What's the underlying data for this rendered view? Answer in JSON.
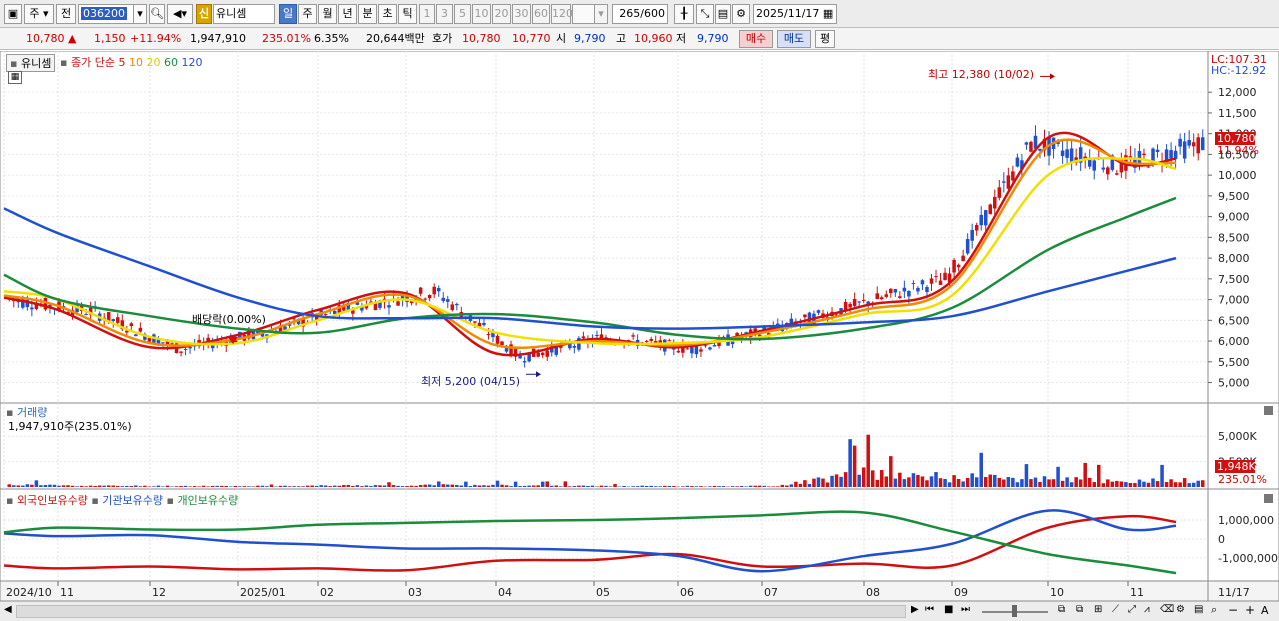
{
  "toolbar": {
    "market": "주",
    "prev": "전",
    "code": "036200",
    "new_badge": "신",
    "stock_name": "유니셈",
    "periods": [
      "일",
      "주",
      "월",
      "년",
      "분",
      "초",
      "틱"
    ],
    "intervals": [
      "1",
      "3",
      "5",
      "10",
      "20",
      "30",
      "60",
      "120"
    ],
    "count": "265",
    "count_total": "/600",
    "date": "2025/11/17"
  },
  "quote": {
    "price": "10,780",
    "up_mark": "▲",
    "change": "1,150",
    "change_pct": "+11.94%",
    "volume": "1,947,910",
    "vol_ratio": "235.01%",
    "turnover": "6.35%",
    "amount": "20,644백만",
    "bid_label": "호가",
    "ask_price": "10,780",
    "bid_price": "10,770",
    "open_label": "시",
    "open": "9,790",
    "high_label": "고",
    "high": "10,960",
    "low_label": "저",
    "low": "9,790",
    "buy": "매수",
    "sell": "매도",
    "eval": "평"
  },
  "price_panel": {
    "stock_name": "유니셈",
    "indicator_label": "종가 단순",
    "ma_labels": [
      "5",
      "10",
      "20",
      "60",
      "120"
    ],
    "ma_colors": [
      "#d01010",
      "#f08a00",
      "#f0e000",
      "#1a8c3c",
      "#2050d0"
    ],
    "lc": "LC:107.31",
    "hc": "HC:-12.92",
    "current_price": "10,780",
    "current_pct": "11.94%",
    "high_note": "최고 12,380 (10/02)",
    "low_note": "최저 5,200 (04/15)",
    "dividend_note": "배당락(0.00%)"
  },
  "volume_panel": {
    "title": "거래량",
    "value": "1,947,910주(235.01%)",
    "current": "1,948K",
    "current_pct": "235.01%"
  },
  "holdings_panel": {
    "series": [
      "외국인보유수량",
      "기관보유수량",
      "개인보유수량"
    ],
    "colors": [
      "#d01010",
      "#2050d0",
      "#1a8c3c"
    ]
  },
  "x_axis": {
    "labels": [
      "2024/10",
      "11",
      "12",
      "2025/01",
      "02",
      "03",
      "04",
      "05",
      "06",
      "07",
      "08",
      "09",
      "10",
      "11",
      "11/17"
    ]
  },
  "chart_data": [
    {
      "type": "line",
      "title": "",
      "ylabel": "",
      "ylim": [
        4700,
        12800
      ],
      "y_ticks": [
        "12,000",
        "11,500",
        "11,000",
        "10,500",
        "10,000",
        "9,500",
        "9,000",
        "8,500",
        "8,000",
        "7,500",
        "7,000",
        "6,500",
        "6,000",
        "5,500",
        "5,000"
      ],
      "x": [
        "2024/10",
        "2024/11",
        "2024/12",
        "2025/01",
        "2025/02",
        "2025/03",
        "2025/04",
        "2025/05",
        "2025/06",
        "2025/07",
        "2025/08",
        "2025/09",
        "2025/10",
        "2025/11",
        "11/17"
      ],
      "series": [
        {
          "name": "종가",
          "values": [
            7000,
            6700,
            5800,
            6200,
            6800,
            7200,
            5600,
            6100,
            5800,
            6300,
            6900,
            7500,
            10800,
            10200,
            10780
          ]
        },
        {
          "name": "5",
          "values": [
            7050,
            6750,
            5850,
            6150,
            6750,
            7150,
            5700,
            6050,
            5850,
            6250,
            6850,
            7450,
            10900,
            10250,
            10400
          ]
        },
        {
          "name": "10",
          "values": [
            7100,
            6850,
            5950,
            6050,
            6650,
            7100,
            5900,
            6000,
            5900,
            6200,
            6750,
            7350,
            10700,
            10300,
            10300
          ]
        },
        {
          "name": "20",
          "values": [
            7200,
            7000,
            6100,
            5950,
            6500,
            7000,
            6200,
            5950,
            5950,
            6100,
            6650,
            7100,
            10000,
            10400,
            10150
          ]
        },
        {
          "name": "60",
          "values": [
            7600,
            7000,
            6600,
            6300,
            6200,
            6550,
            6650,
            6450,
            6150,
            6050,
            6300,
            6800,
            8200,
            9000,
            9450
          ]
        },
        {
          "name": "120",
          "values": [
            9200,
            8600,
            7800,
            7050,
            6600,
            6550,
            6550,
            6350,
            6300,
            6350,
            6450,
            6600,
            7200,
            7700,
            8000
          ]
        }
      ]
    },
    {
      "type": "bar",
      "title": "거래량",
      "y_ticks": [
        "5,000K",
        "2,500K"
      ],
      "x": [
        "2024/10",
        "2024/11",
        "2024/12",
        "2025/01",
        "2025/02",
        "2025/03",
        "2025/04",
        "2025/05",
        "2025/06",
        "2025/07",
        "2025/08",
        "2025/09",
        "2025/10",
        "2025/11",
        "11/17"
      ],
      "values": [
        700,
        350,
        300,
        280,
        450,
        600,
        500,
        300,
        250,
        300,
        4100,
        3000,
        2600,
        1700,
        1948
      ]
    },
    {
      "type": "line",
      "title": "",
      "y_ticks": [
        "1,000,000",
        "0",
        "-1,000,000"
      ],
      "x": [
        "2024/10",
        "2024/11",
        "2024/12",
        "2025/01",
        "2025/02",
        "2025/03",
        "2025/04",
        "2025/05",
        "2025/06",
        "2025/07",
        "2025/08",
        "2025/09",
        "2025/10",
        "2025/11",
        "11/17"
      ],
      "series": [
        {
          "name": "외국인보유수량",
          "values": [
            -1400000,
            -1550000,
            -1450000,
            -1600000,
            -1550000,
            -1650000,
            -1150000,
            -1100000,
            -800000,
            -1450000,
            -1300000,
            -1400000,
            600000,
            1200000,
            900000
          ]
        },
        {
          "name": "기관보유수량",
          "values": [
            300000,
            150000,
            200000,
            -150000,
            -300000,
            -500000,
            -500000,
            -600000,
            -900000,
            -1700000,
            -900000,
            -250000,
            1500000,
            500000,
            700000
          ]
        },
        {
          "name": "개인보유수량",
          "values": [
            350000,
            600000,
            500000,
            500000,
            750000,
            850000,
            950000,
            1000000,
            1100000,
            1250000,
            1400000,
            400000,
            -800000,
            -1400000,
            -1800000
          ]
        }
      ]
    }
  ]
}
